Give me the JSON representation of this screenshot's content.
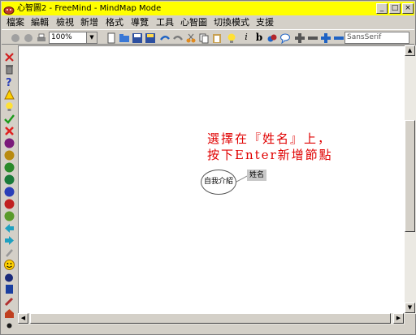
{
  "window": {
    "title": "心智圖2 - FreeMind - MindMap Mode",
    "minimize_glyph": "_",
    "maximize_glyph": "□",
    "close_glyph": "×",
    "titlebar_color": "#ffff00"
  },
  "menu": [
    {
      "label": "檔案"
    },
    {
      "label": "編輯"
    },
    {
      "label": "檢視"
    },
    {
      "label": "新增"
    },
    {
      "label": "格式"
    },
    {
      "label": "導覽"
    },
    {
      "label": "工具"
    },
    {
      "label": "心智圖"
    },
    {
      "label": "切換模式"
    },
    {
      "label": "支援"
    }
  ],
  "toolbar": {
    "zoom_value": "100%",
    "font_name": "SansSerif",
    "icons": [
      "back-icon",
      "forward-icon",
      "print-icon",
      "new-icon",
      "open-icon",
      "save-icon",
      "save-as-icon",
      "undo-icon",
      "redo-icon",
      "cut-icon",
      "copy-icon",
      "paste-icon",
      "idea-icon",
      "italic-icon",
      "bold-icon",
      "cloud-icon",
      "note-icon",
      "zoom-in-icon",
      "zoom-out-icon",
      "font-larger-icon",
      "font-smaller-icon"
    ],
    "italic_glyph": "i",
    "bold_glyph": "b"
  },
  "leftbar_icons": [
    "remove-icon",
    "trash-icon",
    "question-icon",
    "warning-icon",
    "idea-icon",
    "ok-icon",
    "cancel-icon",
    "priority-1-icon",
    "priority-2-icon",
    "priority-3-icon",
    "priority-4-icon",
    "priority-5-icon",
    "priority-6-icon",
    "priority-7-icon",
    "back-arrow-icon",
    "forward-arrow-icon",
    "attach-icon",
    "smiley-icon",
    "bomb-icon",
    "book-icon",
    "pencil-icon",
    "home-icon",
    "button-icon"
  ],
  "map": {
    "root_node": "自我介紹",
    "child_node": "姓名",
    "annotation_line1": "選擇在『姓名』上，",
    "annotation_line2": "按下Enter新增節點",
    "annotation_color": "#e00000"
  }
}
